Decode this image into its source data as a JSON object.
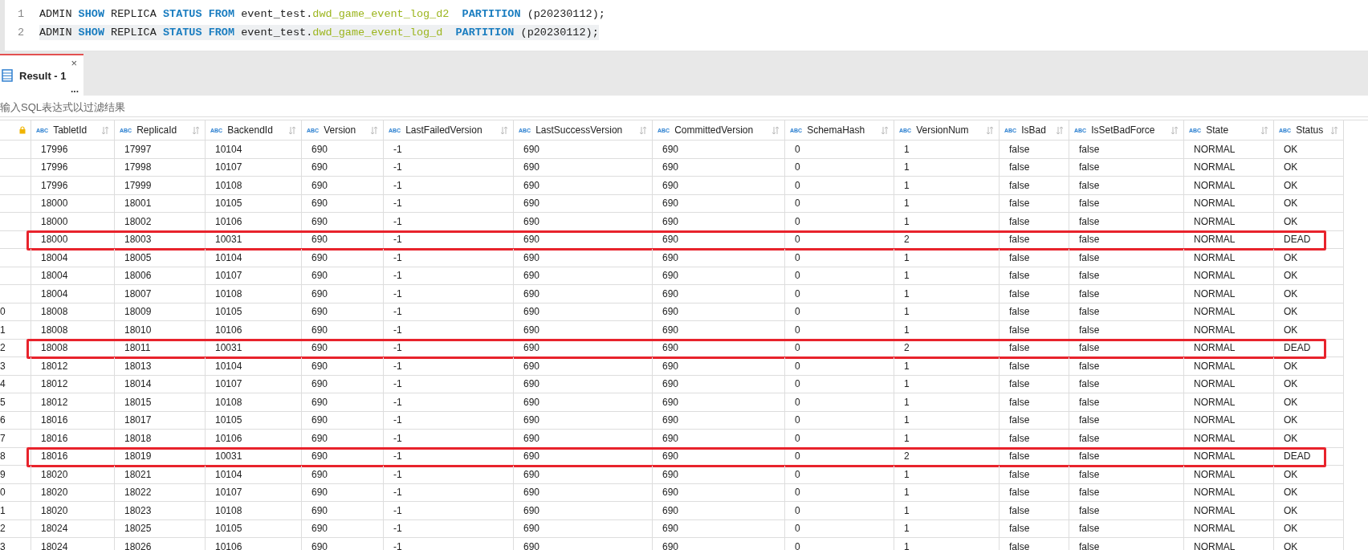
{
  "editor": {
    "lines": [
      {
        "number": "1",
        "current": false,
        "tokens": [
          {
            "text": "ADMIN ",
            "kind": "plain"
          },
          {
            "text": "SHOW",
            "kind": "keyword"
          },
          {
            "text": " REPLICA ",
            "kind": "plain"
          },
          {
            "text": "STATUS",
            "kind": "keyword"
          },
          {
            "text": " FROM",
            "kind": "keyword"
          },
          {
            "text": " event_test.",
            "kind": "plain"
          },
          {
            "text": "dwd_game_event_log_d2",
            "kind": "identifier"
          },
          {
            "text": "  PARTITION",
            "kind": "keyword"
          },
          {
            "text": " (p20230112);",
            "kind": "plain"
          }
        ]
      },
      {
        "number": "2",
        "current": true,
        "tokens": [
          {
            "text": "ADMIN ",
            "kind": "plain"
          },
          {
            "text": "SHOW",
            "kind": "keyword"
          },
          {
            "text": " REPLICA ",
            "kind": "plain"
          },
          {
            "text": "STATUS",
            "kind": "keyword"
          },
          {
            "text": " FROM",
            "kind": "keyword"
          },
          {
            "text": " event_test.",
            "kind": "plain"
          },
          {
            "text": "dwd_game_event_log_d",
            "kind": "identifier"
          },
          {
            "text": "  PARTITION",
            "kind": "keyword"
          },
          {
            "text": " (p20230112);",
            "kind": "plain"
          }
        ]
      }
    ]
  },
  "tabs": [
    {
      "label": "Result - 1",
      "selected": true,
      "more": "...",
      "close": "×"
    }
  ],
  "filter": {
    "placeholder": "输入SQL表达式以过滤结果"
  },
  "table": {
    "columns": [
      {
        "label": "TabletId",
        "type": "ABC"
      },
      {
        "label": "ReplicaId",
        "type": "ABC"
      },
      {
        "label": "BackendId",
        "type": "ABC"
      },
      {
        "label": "Version",
        "type": "ABC"
      },
      {
        "label": "LastFailedVersion",
        "type": "ABC"
      },
      {
        "label": "LastSuccessVersion",
        "type": "ABC"
      },
      {
        "label": "CommittedVersion",
        "type": "ABC"
      },
      {
        "label": "SchemaHash",
        "type": "ABC"
      },
      {
        "label": "VersionNum",
        "type": "ABC"
      },
      {
        "label": "IsBad",
        "type": "ABC"
      },
      {
        "label": "IsSetBadForce",
        "type": "ABC"
      },
      {
        "label": "State",
        "type": "ABC"
      },
      {
        "label": "Status",
        "type": "ABC"
      }
    ],
    "rows": [
      {
        "highlighted": false,
        "cells": [
          "17996",
          "17997",
          "10104",
          "690",
          "-1",
          "690",
          "690",
          "0",
          "1",
          "false",
          "false",
          "NORMAL",
          "OK"
        ]
      },
      {
        "highlighted": false,
        "cells": [
          "17996",
          "17998",
          "10107",
          "690",
          "-1",
          "690",
          "690",
          "0",
          "1",
          "false",
          "false",
          "NORMAL",
          "OK"
        ]
      },
      {
        "highlighted": false,
        "cells": [
          "17996",
          "17999",
          "10108",
          "690",
          "-1",
          "690",
          "690",
          "0",
          "1",
          "false",
          "false",
          "NORMAL",
          "OK"
        ]
      },
      {
        "highlighted": false,
        "cells": [
          "18000",
          "18001",
          "10105",
          "690",
          "-1",
          "690",
          "690",
          "0",
          "1",
          "false",
          "false",
          "NORMAL",
          "OK"
        ]
      },
      {
        "highlighted": false,
        "cells": [
          "18000",
          "18002",
          "10106",
          "690",
          "-1",
          "690",
          "690",
          "0",
          "1",
          "false",
          "false",
          "NORMAL",
          "OK"
        ]
      },
      {
        "highlighted": true,
        "cells": [
          "18000",
          "18003",
          "10031",
          "690",
          "-1",
          "690",
          "690",
          "0",
          "2",
          "false",
          "false",
          "NORMAL",
          "DEAD"
        ]
      },
      {
        "highlighted": false,
        "cells": [
          "18004",
          "18005",
          "10104",
          "690",
          "-1",
          "690",
          "690",
          "0",
          "1",
          "false",
          "false",
          "NORMAL",
          "OK"
        ]
      },
      {
        "highlighted": false,
        "cells": [
          "18004",
          "18006",
          "10107",
          "690",
          "-1",
          "690",
          "690",
          "0",
          "1",
          "false",
          "false",
          "NORMAL",
          "OK"
        ]
      },
      {
        "highlighted": false,
        "cells": [
          "18004",
          "18007",
          "10108",
          "690",
          "-1",
          "690",
          "690",
          "0",
          "1",
          "false",
          "false",
          "NORMAL",
          "OK"
        ]
      },
      {
        "row_number": "0",
        "highlighted": false,
        "cells": [
          "18008",
          "18009",
          "10105",
          "690",
          "-1",
          "690",
          "690",
          "0",
          "1",
          "false",
          "false",
          "NORMAL",
          "OK"
        ]
      },
      {
        "row_number": "1",
        "highlighted": false,
        "cells": [
          "18008",
          "18010",
          "10106",
          "690",
          "-1",
          "690",
          "690",
          "0",
          "1",
          "false",
          "false",
          "NORMAL",
          "OK"
        ]
      },
      {
        "row_number": "2",
        "highlighted": true,
        "cells": [
          "18008",
          "18011",
          "10031",
          "690",
          "-1",
          "690",
          "690",
          "0",
          "2",
          "false",
          "false",
          "NORMAL",
          "DEAD"
        ]
      },
      {
        "row_number": "3",
        "highlighted": false,
        "cells": [
          "18012",
          "18013",
          "10104",
          "690",
          "-1",
          "690",
          "690",
          "0",
          "1",
          "false",
          "false",
          "NORMAL",
          "OK"
        ]
      },
      {
        "row_number": "4",
        "highlighted": false,
        "cells": [
          "18012",
          "18014",
          "10107",
          "690",
          "-1",
          "690",
          "690",
          "0",
          "1",
          "false",
          "false",
          "NORMAL",
          "OK"
        ]
      },
      {
        "row_number": "5",
        "highlighted": false,
        "cells": [
          "18012",
          "18015",
          "10108",
          "690",
          "-1",
          "690",
          "690",
          "0",
          "1",
          "false",
          "false",
          "NORMAL",
          "OK"
        ]
      },
      {
        "row_number": "6",
        "highlighted": false,
        "cells": [
          "18016",
          "18017",
          "10105",
          "690",
          "-1",
          "690",
          "690",
          "0",
          "1",
          "false",
          "false",
          "NORMAL",
          "OK"
        ]
      },
      {
        "row_number": "7",
        "highlighted": false,
        "cells": [
          "18016",
          "18018",
          "10106",
          "690",
          "-1",
          "690",
          "690",
          "0",
          "1",
          "false",
          "false",
          "NORMAL",
          "OK"
        ]
      },
      {
        "row_number": "8",
        "highlighted": true,
        "cells": [
          "18016",
          "18019",
          "10031",
          "690",
          "-1",
          "690",
          "690",
          "0",
          "2",
          "false",
          "false",
          "NORMAL",
          "DEAD"
        ]
      },
      {
        "row_number": "9",
        "highlighted": false,
        "cells": [
          "18020",
          "18021",
          "10104",
          "690",
          "-1",
          "690",
          "690",
          "0",
          "1",
          "false",
          "false",
          "NORMAL",
          "OK"
        ]
      },
      {
        "row_number": "0",
        "highlighted": false,
        "cells": [
          "18020",
          "18022",
          "10107",
          "690",
          "-1",
          "690",
          "690",
          "0",
          "1",
          "false",
          "false",
          "NORMAL",
          "OK"
        ]
      },
      {
        "row_number": "1",
        "highlighted": false,
        "cells": [
          "18020",
          "18023",
          "10108",
          "690",
          "-1",
          "690",
          "690",
          "0",
          "1",
          "false",
          "false",
          "NORMAL",
          "OK"
        ]
      },
      {
        "row_number": "2",
        "highlighted": false,
        "cells": [
          "18024",
          "18025",
          "10105",
          "690",
          "-1",
          "690",
          "690",
          "0",
          "1",
          "false",
          "false",
          "NORMAL",
          "OK"
        ]
      },
      {
        "row_number": "3",
        "highlighted": false,
        "cells": [
          "18024",
          "18026",
          "10106",
          "690",
          "-1",
          "690",
          "690",
          "0",
          "1",
          "false",
          "false",
          "NORMAL",
          "OK"
        ]
      }
    ]
  }
}
